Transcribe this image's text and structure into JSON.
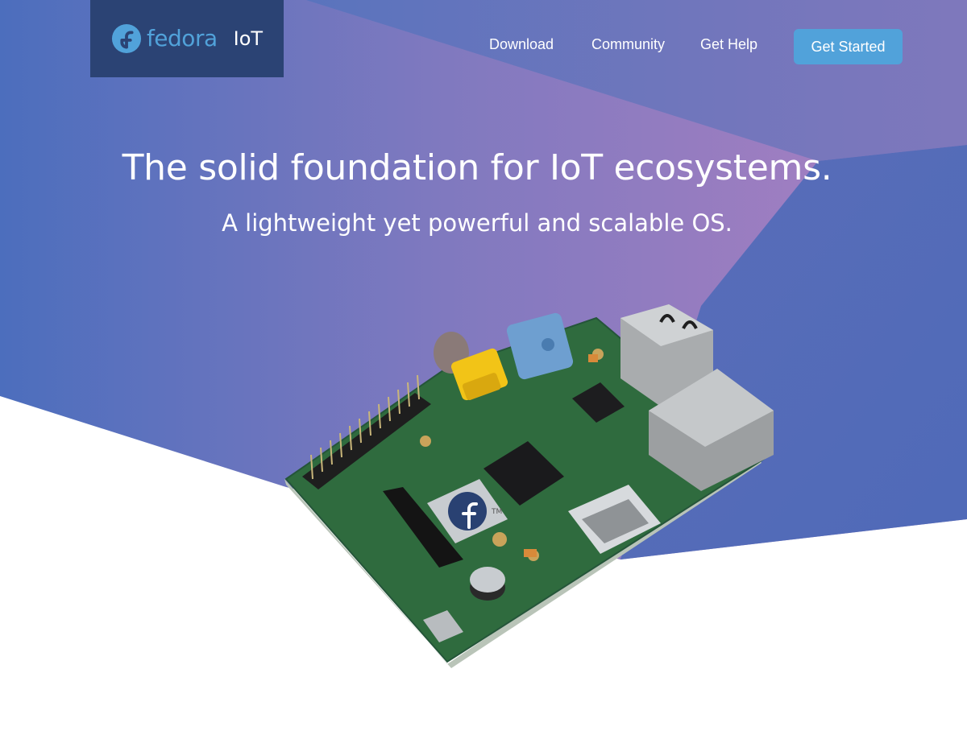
{
  "brand": {
    "wordmark": "fedora",
    "product": "IoT",
    "logo_icon": "fedora-logo-icon"
  },
  "nav": {
    "links": [
      "Download",
      "Community",
      "Get Help"
    ],
    "cta_label": "Get Started"
  },
  "hero": {
    "title": "The solid foundation for IoT ecosystems.",
    "subtitle": "A lightweight yet powerful and scalable OS."
  },
  "illustration": {
    "icon": "single-board-computer-illustration",
    "badge_icon": "fedora-logo-icon",
    "badge_mark": "TM"
  },
  "colors": {
    "brand_box": "#2b4374",
    "accent": "#51a2da",
    "gradient_left": "#4a6fbe",
    "gradient_right": "#a07ec0",
    "pcb_green": "#2f6b3e",
    "text": "#ffffff"
  }
}
